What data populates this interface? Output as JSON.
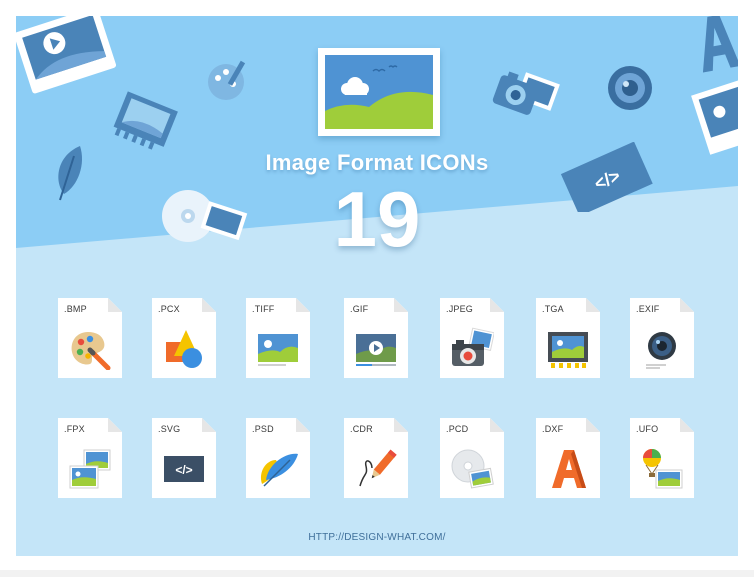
{
  "poster": {
    "title": "Image Format ICONs",
    "count": "19",
    "footer_url": "HTTP://DESIGN-WHAT.COM/",
    "colors": {
      "sky_dark": "#8ccdf5",
      "sky_light": "#c4e5f8",
      "icon_blue": "#4a84b8",
      "grass_green": "#9fcd3a",
      "accent_orange": "#f06b2a"
    }
  },
  "decorations": [
    "photo-frame-play-icon",
    "palette-brush-icon",
    "film-strip-icon",
    "feather-icon",
    "cd-disc-icon",
    "camera-icon",
    "lens-icon",
    "letter-a-icon",
    "svg-code-frame-icon",
    "picture-frame-icon"
  ],
  "rows": [
    [
      {
        "ext": ".BMP",
        "icon": "palette-icon"
      },
      {
        "ext": ".PCX",
        "icon": "shapes-icon"
      },
      {
        "ext": ".TIFF",
        "icon": "landscape-icon"
      },
      {
        "ext": ".GIF",
        "icon": "video-play-icon"
      },
      {
        "ext": ".JPEG",
        "icon": "camera-icon"
      },
      {
        "ext": ".TGA",
        "icon": "film-frame-icon"
      },
      {
        "ext": ".EXIF",
        "icon": "lens-icon"
      }
    ],
    [
      {
        "ext": ".FPX",
        "icon": "stacked-photos-icon"
      },
      {
        "ext": ".SVG",
        "icon": "code-icon"
      },
      {
        "ext": ".PSD",
        "icon": "feather-icon"
      },
      {
        "ext": ".CDR",
        "icon": "pencil-icon"
      },
      {
        "ext": ".PCD",
        "icon": "disc-photo-icon"
      },
      {
        "ext": ".DXF",
        "icon": "letter-a-icon"
      },
      {
        "ext": ".UFO",
        "icon": "balloon-photo-icon"
      }
    ]
  ]
}
